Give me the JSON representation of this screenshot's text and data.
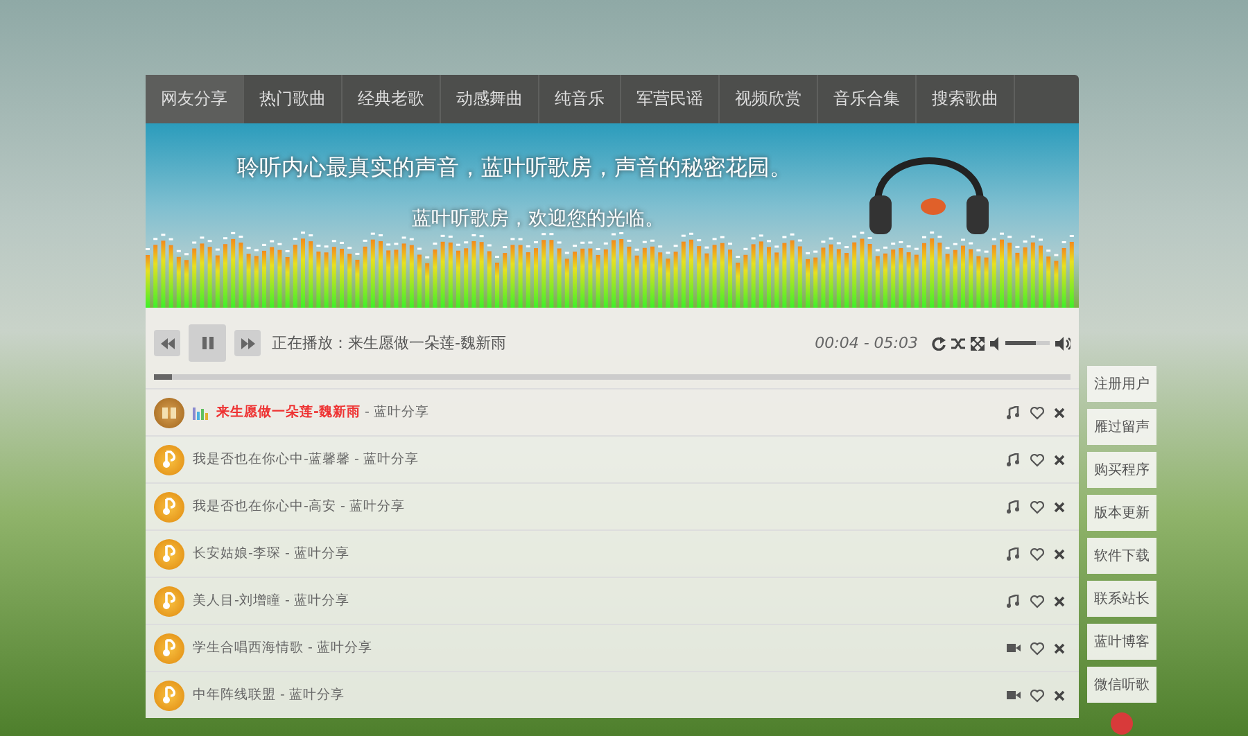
{
  "nav": [
    {
      "label": "网友分享",
      "selected": true
    },
    {
      "label": "热门歌曲",
      "selected": false
    },
    {
      "label": "经典老歌",
      "selected": false
    },
    {
      "label": "动感舞曲",
      "selected": false
    },
    {
      "label": "纯音乐",
      "selected": false
    },
    {
      "label": "军营民谣",
      "selected": false
    },
    {
      "label": "视频欣赏",
      "selected": false
    },
    {
      "label": "音乐合集",
      "selected": false
    },
    {
      "label": "搜索歌曲",
      "selected": false
    }
  ],
  "banner": {
    "headline": "聆听内心最真实的声音，蓝叶听歌房，声音的秘密花园。",
    "welcome": "蓝叶听歌房，欢迎您的光临。"
  },
  "player": {
    "now_playing": "正在播放：来生愿做一朵莲-魏新雨",
    "time": "00:04 - 05:03",
    "progress": {
      "level": 0.02
    },
    "volume": {
      "level": 0.7
    }
  },
  "playlist": [
    {
      "title": "来生愿做一朵莲-魏新雨",
      "source": "- 蓝叶分享",
      "kind": "audio",
      "playing": true
    },
    {
      "title": "我是否也在你心中-蓝馨馨",
      "source": "- 蓝叶分享",
      "kind": "audio",
      "playing": false
    },
    {
      "title": "我是否也在你心中-高安",
      "source": "- 蓝叶分享",
      "kind": "audio",
      "playing": false
    },
    {
      "title": "长安姑娘-李琛",
      "source": "- 蓝叶分享",
      "kind": "audio",
      "playing": false
    },
    {
      "title": "美人目-刘增瞳",
      "source": "- 蓝叶分享",
      "kind": "audio",
      "playing": false
    },
    {
      "title": "学生合唱西海情歌",
      "source": "- 蓝叶分享",
      "kind": "video",
      "playing": false
    },
    {
      "title": "中年阵线联盟",
      "source": "- 蓝叶分享",
      "kind": "video",
      "playing": false
    }
  ],
  "side_menu": [
    "注册用户",
    "雁过留声",
    "购买程序",
    "版本更新",
    "软件下载",
    "联系站长",
    "蓝叶博客",
    "微信听歌"
  ]
}
